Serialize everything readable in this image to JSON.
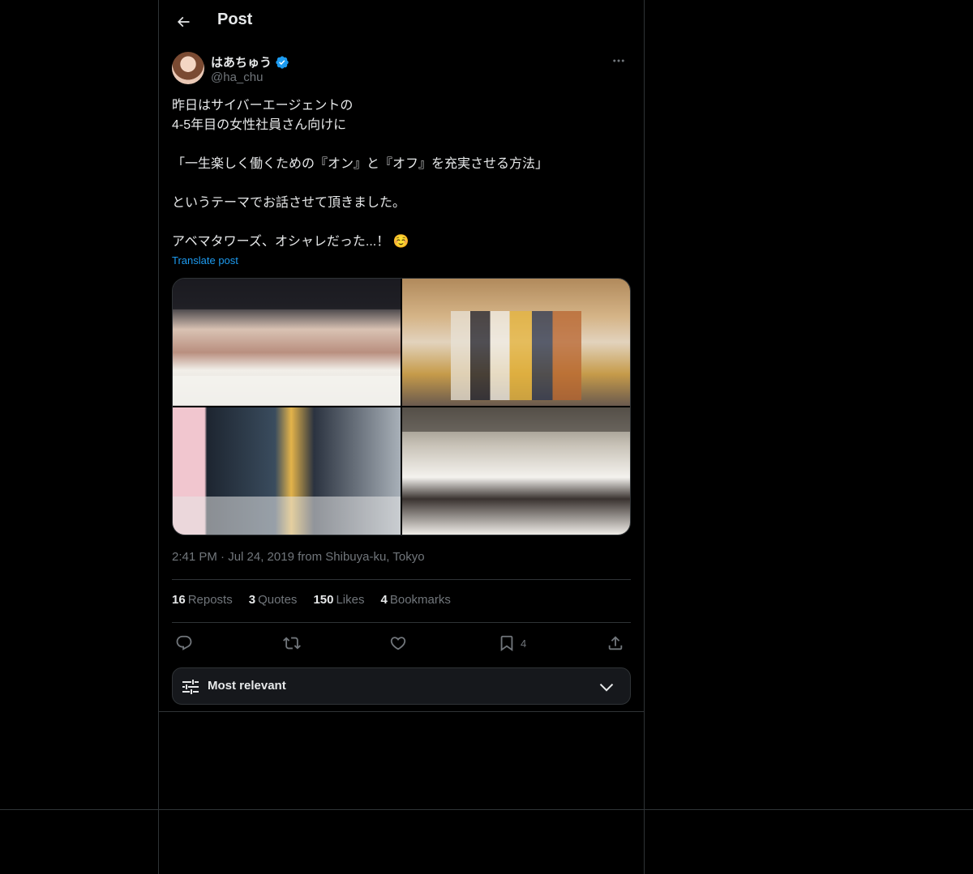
{
  "header": {
    "title": "Post"
  },
  "author": {
    "display_name": "はあちゅう",
    "handle": "@ha_chu",
    "verified": true
  },
  "tweet": {
    "lines": [
      "昨日はサイバーエージェントの",
      "4-5年目の女性社員さん向けに",
      "",
      "「一生楽しく働くための『オン』と『オフ』を充実させる方法」",
      "",
      "というテーマでお話させて頂きました。",
      "",
      "アベマタワーズ、オシャレだった...！"
    ],
    "emoji": "☺️",
    "translate_label": "Translate post",
    "timestamp": "2:41 PM · Jul 24, 2019 from Shibuya-ku, Tokyo"
  },
  "stats": {
    "reposts_count": "16",
    "reposts_label": "Reposts",
    "quotes_count": "3",
    "quotes_label": "Quotes",
    "likes_count": "150",
    "likes_label": "Likes",
    "bookmarks_count": "4",
    "bookmarks_label": "Bookmarks"
  },
  "actions": {
    "bookmark_count": "4"
  },
  "sort": {
    "label": "Most relevant"
  },
  "colors": {
    "background": "#000000",
    "text": "#e7e9ea",
    "muted": "#71767b",
    "accent": "#1d9bf0",
    "border": "#2f3336"
  },
  "icons": {
    "back": "arrow-left-icon",
    "verified": "verified-badge-icon",
    "more": "more-horizontal-icon",
    "reply": "reply-icon",
    "repost": "repost-icon",
    "like": "heart-icon",
    "bookmark": "bookmark-icon",
    "share": "share-icon",
    "sort": "sliders-icon",
    "chevron": "chevron-down-icon"
  }
}
